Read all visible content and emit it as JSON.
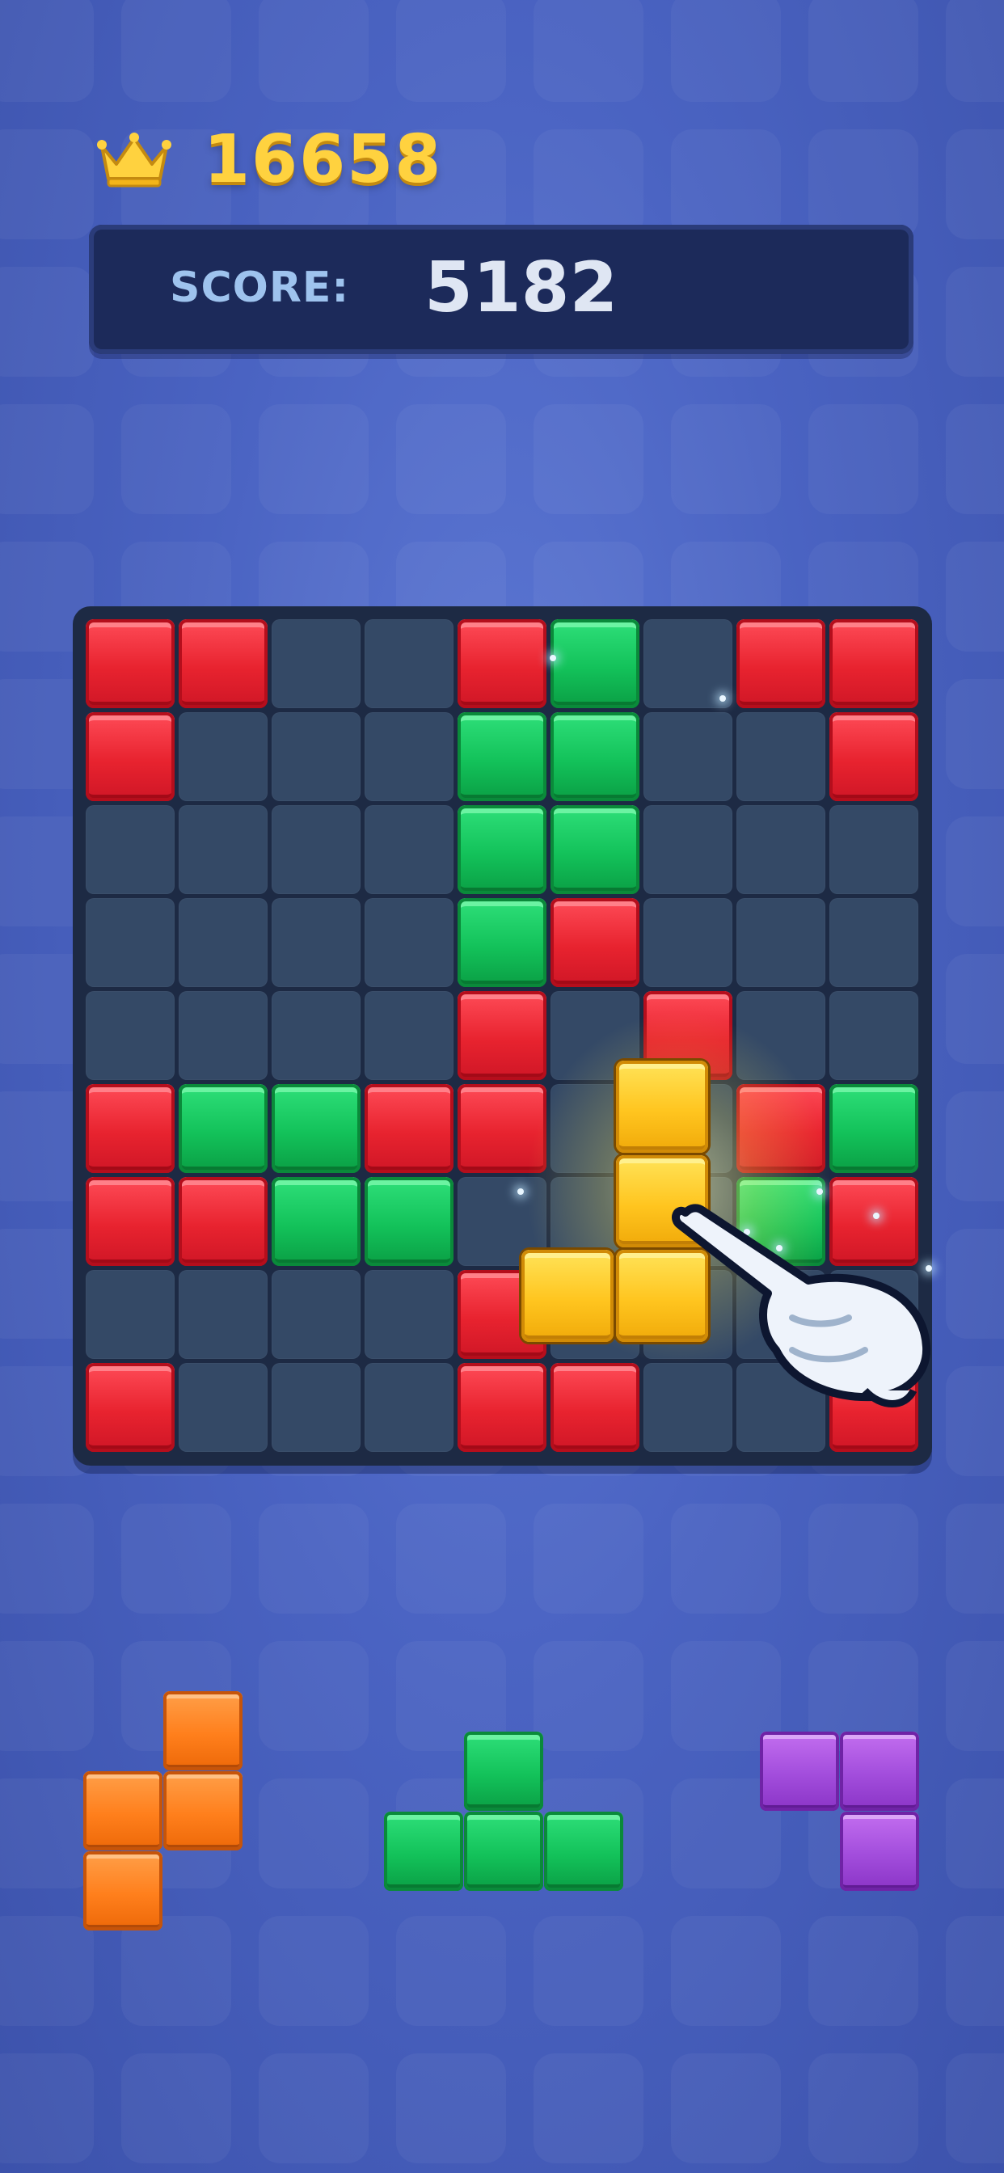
{
  "header": {
    "best_icon": "crown-icon",
    "best_score": "16658",
    "score_label": "SCORE:",
    "score_value": "5182"
  },
  "colors": {
    "red": "#e8232f",
    "green": "#13c25a",
    "yellow": "#ffc51f",
    "orange": "#ff7f1c",
    "purple": "#a24ddc",
    "empty": "#344966",
    "board": "#1d2a44",
    "background": "#4a63c2",
    "best_score": "#ffd23f"
  },
  "board": {
    "rows": 9,
    "cols": 9,
    "grid": [
      [
        "R",
        "R",
        "",
        "",
        "R",
        "G",
        "",
        "R",
        "R"
      ],
      [
        "R",
        "",
        "",
        "",
        "G",
        "G",
        "",
        "",
        "R"
      ],
      [
        "",
        "",
        "",
        "",
        "G",
        "G",
        "",
        "",
        ""
      ],
      [
        "",
        "",
        "",
        "",
        "G",
        "R",
        "",
        "",
        ""
      ],
      [
        "",
        "",
        "",
        "",
        "R",
        "",
        "R",
        "",
        ""
      ],
      [
        "R",
        "G",
        "G",
        "R",
        "R",
        "",
        "",
        "R",
        "G"
      ],
      [
        "R",
        "R",
        "G",
        "G",
        "",
        "",
        "",
        "G",
        "R"
      ],
      [
        "",
        "",
        "",
        "",
        "R",
        "",
        "",
        "",
        ""
      ],
      [
        "R",
        "",
        "",
        "",
        "R",
        "R",
        "",
        "",
        "R"
      ]
    ],
    "dragging_piece": {
      "color": "yellow",
      "cells": [
        [
          0,
          1
        ],
        [
          1,
          1
        ],
        [
          2,
          0
        ],
        [
          2,
          1
        ]
      ]
    },
    "tutorial_icon": "pointing-hand-icon"
  },
  "tray": {
    "pieces": [
      {
        "name": "orange-s-piece",
        "color": "orange",
        "cells": [
          [
            0,
            1
          ],
          [
            1,
            0
          ],
          [
            1,
            1
          ],
          [
            2,
            0
          ]
        ]
      },
      {
        "name": "green-t-piece",
        "color": "green",
        "cells": [
          [
            0,
            1
          ],
          [
            1,
            0
          ],
          [
            1,
            1
          ],
          [
            1,
            2
          ]
        ]
      },
      {
        "name": "purple-corner-piece",
        "color": "purple",
        "cells": [
          [
            0,
            0
          ],
          [
            0,
            1
          ],
          [
            1,
            1
          ]
        ]
      }
    ]
  }
}
